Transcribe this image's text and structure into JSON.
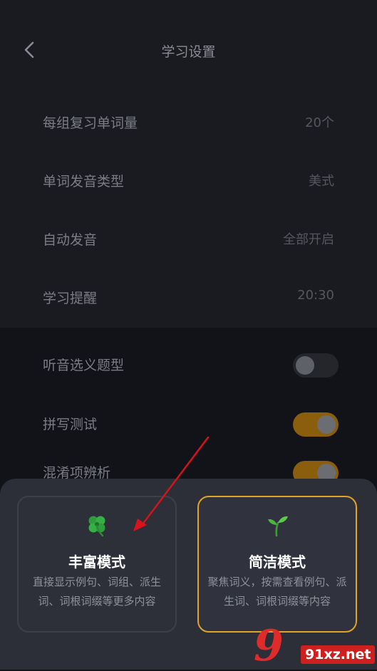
{
  "header": {
    "title": "学习设置",
    "back_icon": "chevron-left-icon"
  },
  "settings": [
    {
      "label": "每组复习单词量",
      "value": "20个"
    },
    {
      "label": "单词发音类型",
      "value": "美式"
    },
    {
      "label": "自动发音",
      "value": "全部开启"
    },
    {
      "label": "学习提醒",
      "value": "20:30"
    }
  ],
  "toggles": [
    {
      "label": "听音选义题型",
      "on": false
    },
    {
      "label": "拼写测试",
      "on": true
    },
    {
      "label": "混淆项辨析",
      "on": true
    }
  ],
  "modes": [
    {
      "icon": "clover-icon",
      "name": "丰富模式",
      "desc": "直接显示例句、词组、派生词、词根词缀等更多内容",
      "selected": false
    },
    {
      "icon": "sprout-icon",
      "name": "简洁模式",
      "desc": "聚焦词义，按需查看例句、派生词、词根词缀等内容",
      "selected": true
    }
  ],
  "watermark": {
    "text": "91xz.net"
  },
  "colors": {
    "accent": "#e3a324",
    "toggle_on": "#8a5e0c",
    "arrow": "#d8131b"
  }
}
